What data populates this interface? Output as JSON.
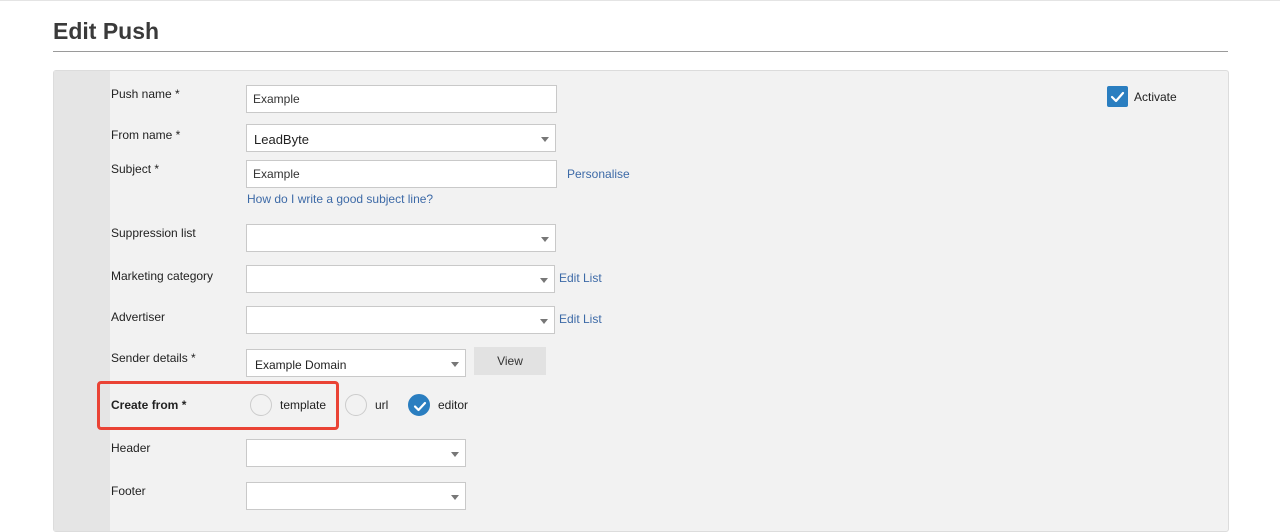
{
  "page": {
    "title": "Edit Push"
  },
  "form": {
    "push_name": {
      "label": "Push name *",
      "value": "Example"
    },
    "from_name": {
      "label": "From name *",
      "value": "LeadByte"
    },
    "subject": {
      "label": "Subject *",
      "value": "Example",
      "personalise_link": "Personalise",
      "help_link": "How do I write a good subject line?"
    },
    "suppression_list": {
      "label": "Suppression list",
      "value": ""
    },
    "marketing_category": {
      "label": "Marketing category",
      "value": "",
      "edit_link": "Edit List"
    },
    "advertiser": {
      "label": "Advertiser",
      "value": "",
      "edit_link": "Edit List"
    },
    "sender_details": {
      "label": "Sender details *",
      "value": "Example Domain",
      "view_button": "View"
    },
    "create_from": {
      "label": "Create from *",
      "options": [
        {
          "label": "template",
          "selected": false
        },
        {
          "label": "url",
          "selected": false
        },
        {
          "label": "editor",
          "selected": true
        }
      ]
    },
    "header": {
      "label": "Header",
      "value": ""
    },
    "footer": {
      "label": "Footer",
      "value": ""
    }
  },
  "activate": {
    "label": "Activate",
    "checked": true
  },
  "colors": {
    "accent": "#2a7ec0",
    "link": "#3d6aa7",
    "highlight": "#ea4335"
  },
  "icons": {
    "checkbox": "check-icon",
    "radio_selected": "check-icon",
    "dropdown": "chevron-down-icon"
  }
}
